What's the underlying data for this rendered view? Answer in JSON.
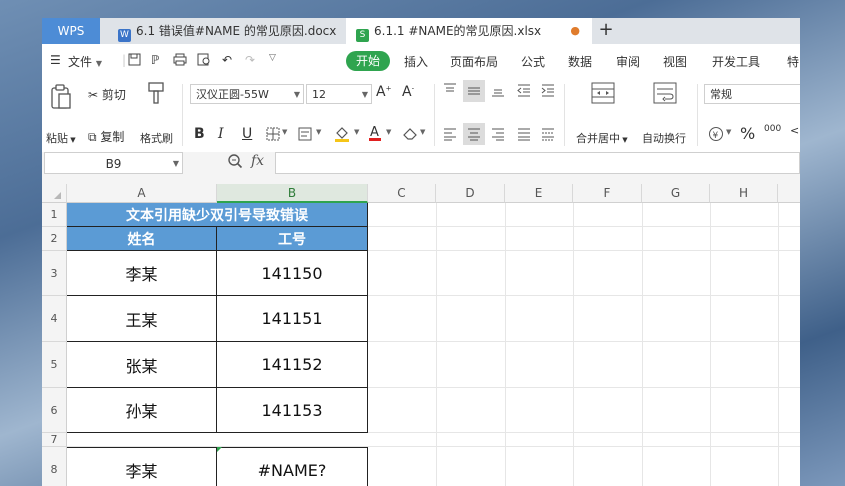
{
  "tabs": {
    "app": "WPS",
    "doc": "6.1 错误值#NAME 的常见原因.docx",
    "sheet": "6.1.1 #NAME的常见原因.xlsx",
    "add": "+"
  },
  "menu": {
    "file": "文件",
    "items": [
      "开始",
      "插入",
      "页面布局",
      "公式",
      "数据",
      "审阅",
      "视图",
      "开发工具",
      "特"
    ]
  },
  "ribbon": {
    "paste": "粘贴",
    "cut": "剪切",
    "copy": "复制",
    "format_painter": "格式刷",
    "font_name": "汉仪正圆-55W",
    "font_size": "12",
    "bold": "B",
    "italic": "I",
    "underline": "U",
    "merge": "合并居中",
    "wrap": "自动换行",
    "number_format": "常规",
    "percent": "%",
    "thousands": "000"
  },
  "formula": {
    "name_box": "B9",
    "fx": "fx",
    "value": ""
  },
  "grid": {
    "columns": [
      "A",
      "B",
      "C",
      "D",
      "E",
      "F",
      "G",
      "H"
    ],
    "rows": [
      "1",
      "2",
      "3",
      "4",
      "5",
      "6",
      "7",
      "8"
    ],
    "title": "文本引用缺少双引号导致错误",
    "header_name": "姓名",
    "header_id": "工号",
    "data": [
      {
        "name": "李某",
        "id": "141150"
      },
      {
        "name": "王某",
        "id": "141151"
      },
      {
        "name": "张某",
        "id": "141152"
      },
      {
        "name": "孙某",
        "id": "141153"
      }
    ],
    "row8": {
      "name": "李某",
      "id": "#NAME?"
    }
  },
  "colors": {
    "accent_green": "#2fa44f",
    "header_blue": "#5b9bd5",
    "wps_blue": "#4d8cd6"
  }
}
